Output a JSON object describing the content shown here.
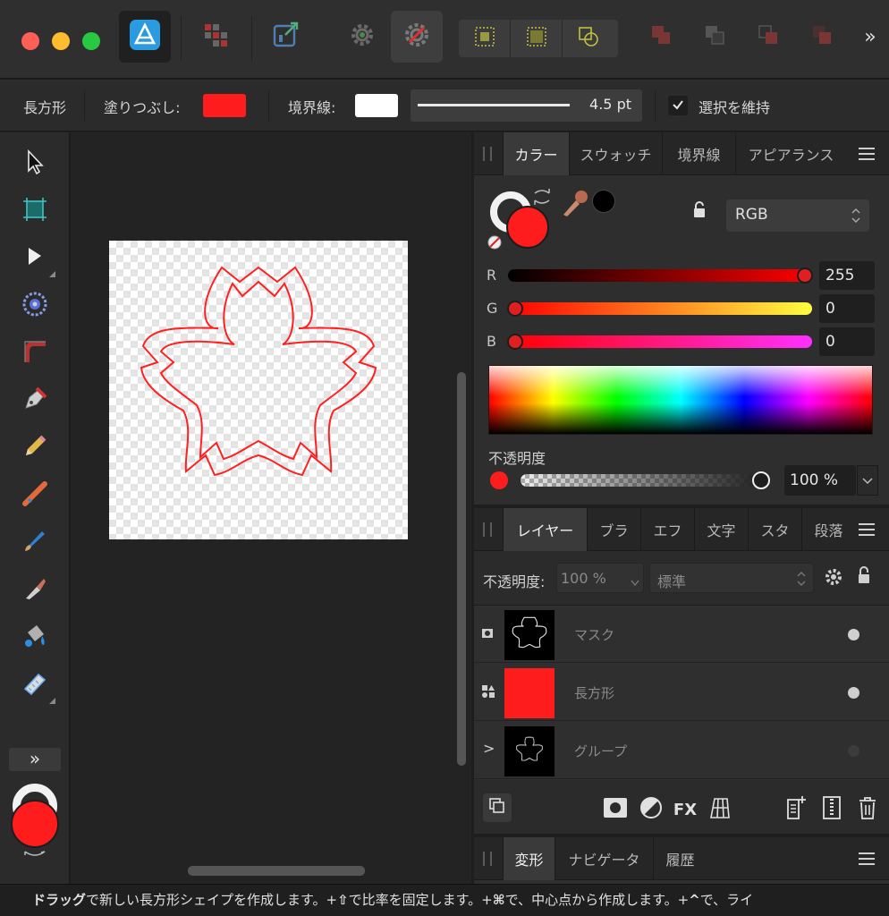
{
  "toolbar": {
    "more_label": "»"
  },
  "context": {
    "tool_name": "長方形",
    "fill_label": "塗りつぶし:",
    "fill_color": "#ff1c1c",
    "stroke_label": "境界線:",
    "stroke_color": "#ffffff",
    "stroke_width": "4.5 pt",
    "keep_selection_label": "選択を維持",
    "keep_selection_checked": true
  },
  "tools": {
    "more_label": "»",
    "primary_color": "#ff1c1c"
  },
  "color_panel": {
    "tabs": [
      "カラー",
      "スウォッチ",
      "境界線",
      "アピアランス"
    ],
    "active_tab": "カラー",
    "mode": "RGB",
    "sliders": [
      {
        "label": "R",
        "value": "255"
      },
      {
        "label": "G",
        "value": "0"
      },
      {
        "label": "B",
        "value": "0"
      }
    ],
    "opacity_label": "不透明度",
    "opacity_value": "100 %"
  },
  "layers_panel": {
    "tabs": [
      "レイヤー",
      "ブラ",
      "エフ",
      "文字",
      "スタ",
      "段落"
    ],
    "active_tab": "レイヤー",
    "opacity_label": "不透明度:",
    "opacity_value": "100 %",
    "blend_mode": "標準",
    "layers": [
      {
        "name": "マスク",
        "type": "mask"
      },
      {
        "name": "長方形",
        "type": "rectangle"
      },
      {
        "name": "グループ",
        "type": "group"
      }
    ],
    "expand_label": ">",
    "fx_label": "FX"
  },
  "transform_panel": {
    "tabs": [
      "変形",
      "ナビゲータ",
      "履歴"
    ],
    "active_tab": "変形"
  },
  "status": {
    "drag": "ドラッグ",
    "text1": "で新しい長方形シェイプを作成します。+",
    "shift": "⇧",
    "text2": "で比率を固定します。+",
    "cmd": "⌘",
    "text3": "で、中心点から作成します。+",
    "ctrl": "^",
    "text4": "で、ライ"
  }
}
